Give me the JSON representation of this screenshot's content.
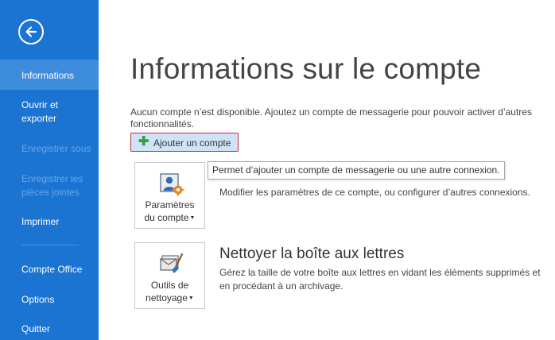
{
  "sidebar": {
    "back_label": "",
    "items": [
      {
        "label": "Informations",
        "state": "active"
      },
      {
        "label": "Ouvrir et exporter",
        "state": "enabled"
      },
      {
        "label": "Enregistrer sous",
        "state": "disabled"
      },
      {
        "label": "Enregistrer les pièces jointes",
        "state": "disabled"
      },
      {
        "label": "Imprimer",
        "state": "enabled"
      },
      {
        "label": "Compte Office",
        "state": "enabled"
      },
      {
        "label": "Options",
        "state": "enabled"
      },
      {
        "label": "Quitter",
        "state": "enabled"
      }
    ]
  },
  "main": {
    "title": "Informations sur le compte",
    "description": "Aucun compte n’est disponible. Ajoutez un compte de messagerie pour pouvoir activer d’autres fonctionnalités.",
    "add_account_label": "Ajouter un compte",
    "tooltip": "Permet d’ajouter un compte de messagerie ou une autre connexion.",
    "sections": [
      {
        "tile_label_line1": "Paramètres",
        "tile_label_line2": "du compte",
        "icon": "account-settings-icon",
        "title": "",
        "description": "Modifier les paramètres de ce compte, ou configurer d’autres connexions."
      },
      {
        "tile_label_line1": "Outils de",
        "tile_label_line2": "nettoyage",
        "icon": "cleanup-tools-icon",
        "title": "Nettoyer la boîte aux lettres",
        "description": "Gérez la taille de votre boîte aux lettres en vidant les éléments supprimés et en procédant à un archivage."
      }
    ]
  },
  "colors": {
    "sidebar_bg": "#1b73d2",
    "sidebar_active": "#3e8ddd",
    "add_button_border": "#c52a46"
  }
}
